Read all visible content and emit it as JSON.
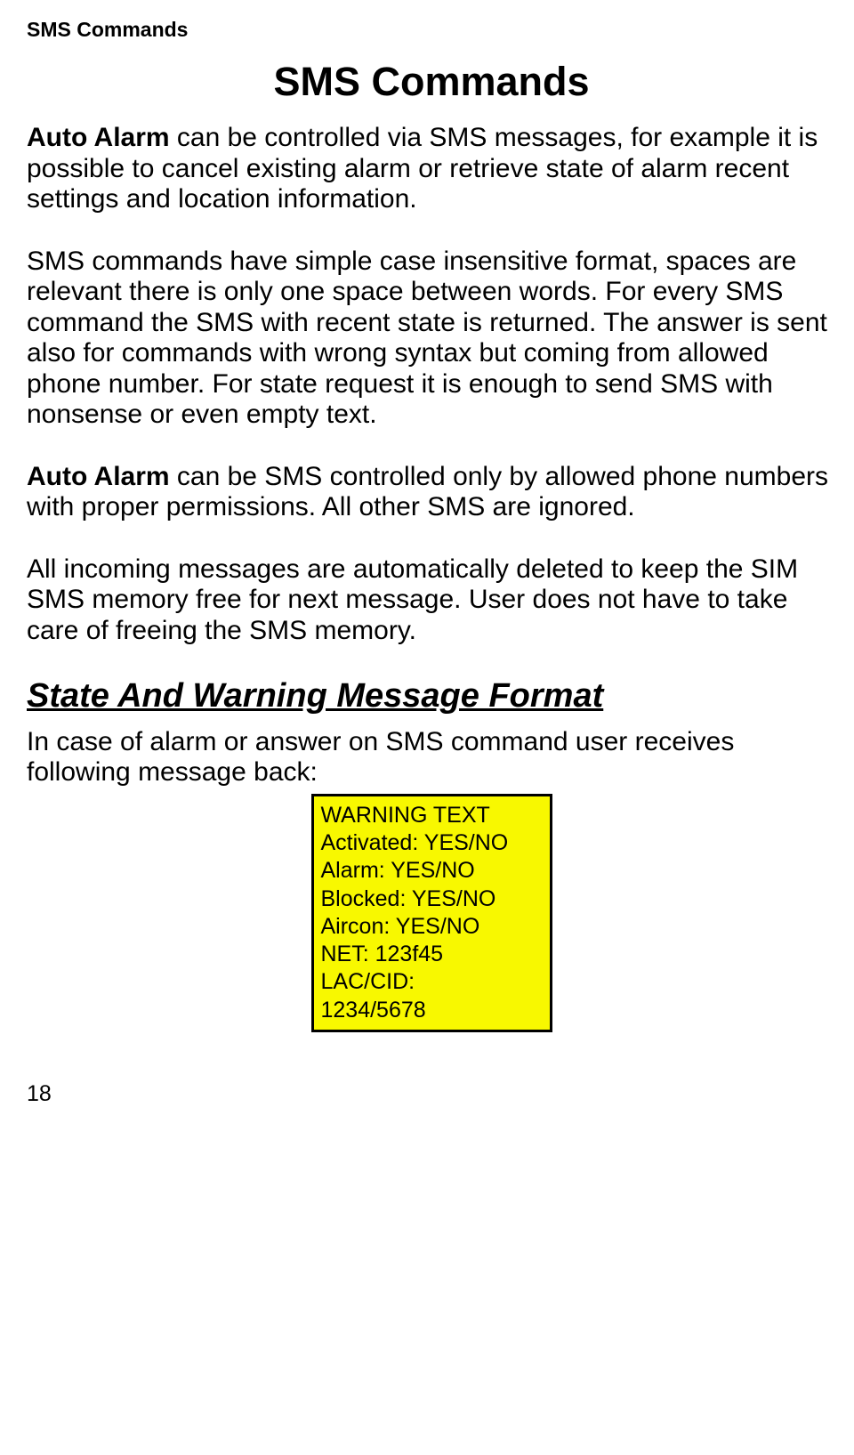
{
  "header": "SMS Commands",
  "title": "SMS Commands",
  "para1_bold": "Auto Alarm",
  "para1_rest": " can be controlled via SMS messages, for example it is possible to cancel existing alarm or retrieve state of alarm recent settings and location information.",
  "para2": "SMS commands have simple case insensitive format, spaces are relevant there is only one space between words. For every SMS command the SMS with recent state is returned. The answer is sent also for commands with wrong syntax but coming from allowed phone number. For state request it is enough to send SMS with nonsense or even empty text.",
  "para3_bold": "Auto Alarm",
  "para3_rest": " can be SMS controlled only by allowed phone numbers with proper permissions. All other SMS are ignored.",
  "para4": "All incoming messages are automatically deleted to keep the SIM SMS memory free for next message. User does not have to take care  of freeing the SMS memory.",
  "subheading": "State And Warning Message Format",
  "para5": "In case of alarm or answer on SMS command user receives following message back:",
  "msg": {
    "l1": "WARNING TEXT",
    "l2": "Activated: YES/NO",
    "l3": "Alarm: YES/NO",
    "l4": "Blocked: YES/NO",
    "l5": "Aircon: YES/NO",
    "l6": "NET: 123f45",
    "l7": "LAC/CID:",
    "l8": "1234/5678"
  },
  "pagenum": "18"
}
